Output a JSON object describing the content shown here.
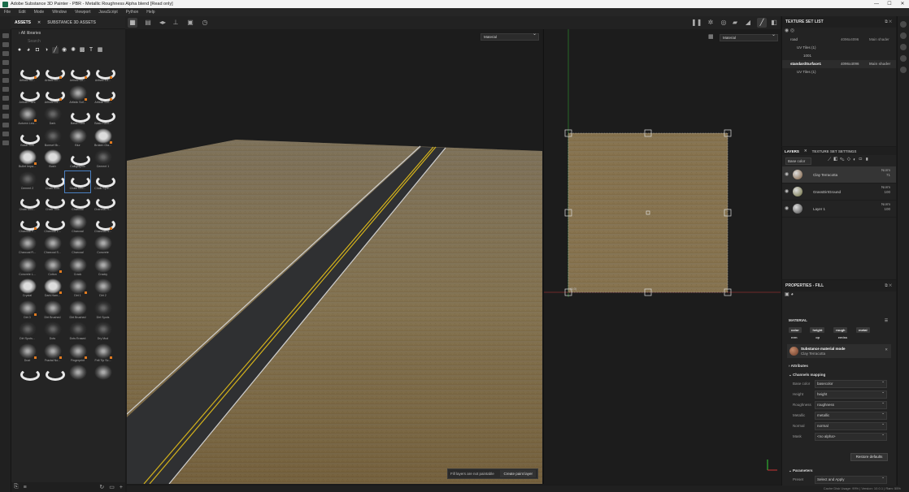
{
  "window": {
    "title": "Adobe Substance 3D Painter - PBR - Metallic Roughness Alpha blend [Read only]",
    "controls": [
      "—",
      "☐",
      "✕"
    ]
  },
  "menu": [
    "File",
    "Edit",
    "Mode",
    "Window",
    "Viewport",
    "JavaScript",
    "Python",
    "Help"
  ],
  "assets": {
    "tabs": [
      "ASSETS",
      "SUBSTANCE 3D ASSETS"
    ],
    "library": "All libraries",
    "search_placeholder": "Search",
    "items": [
      {
        "label": "Artistic He...",
        "kind": "sw",
        "badge": true
      },
      {
        "label": "Artistic Ex...",
        "kind": "sw",
        "badge": true
      },
      {
        "label": "Artistic Ge...",
        "kind": "sw",
        "badge": true
      },
      {
        "label": "Artistic Ed...",
        "kind": "sw",
        "badge": true
      },
      {
        "label": "Artistic Paint",
        "kind": "sw",
        "badge": false
      },
      {
        "label": "Artistic Lol...",
        "kind": "sw",
        "badge": true
      },
      {
        "label": "Artistic Sof...",
        "kind": "g",
        "badge": true
      },
      {
        "label": "Artistic Sof...",
        "kind": "sw",
        "badge": true
      },
      {
        "label": "Autumn Lea...",
        "kind": "g",
        "badge": true
      },
      {
        "label": "Dark",
        "kind": "d",
        "badge": false
      },
      {
        "label": "Basic Hard",
        "kind": "sw",
        "badge": false
      },
      {
        "label": "Basic Hard...",
        "kind": "sw",
        "badge": false
      },
      {
        "label": "Basic Soft",
        "kind": "sw",
        "badge": false
      },
      {
        "label": "Bomsef Br...",
        "kind": "d",
        "badge": false
      },
      {
        "label": "Blur",
        "kind": "g",
        "badge": false
      },
      {
        "label": "Broken Gla...",
        "kind": "w",
        "badge": true
      },
      {
        "label": "Bullet Impa...",
        "kind": "w",
        "badge": true
      },
      {
        "label": "Bush",
        "kind": "w",
        "badge": false
      },
      {
        "label": "Calligraphic",
        "kind": "sw",
        "badge": false
      },
      {
        "label": "Cement 1",
        "kind": "d",
        "badge": false
      },
      {
        "label": "Cement 2",
        "kind": "d",
        "badge": false
      },
      {
        "label": "Chalk Bold",
        "kind": "sw",
        "badge": false
      },
      {
        "label": "Chalk Stro...",
        "kind": "sw",
        "badge": false
      },
      {
        "label": "Chalk Spre...",
        "kind": "sw",
        "badge": false
      },
      {
        "label": "Chalk Stro...",
        "kind": "sw",
        "badge": false
      },
      {
        "label": "Chalk Thin",
        "kind": "sw",
        "badge": false
      },
      {
        "label": "Charcoal",
        "kind": "sw",
        "badge": false
      },
      {
        "label": "Charcoal Fi...",
        "kind": "sw",
        "badge": false
      },
      {
        "label": "Charcoal F...",
        "kind": "sw",
        "badge": true
      },
      {
        "label": "Charcoal L...",
        "kind": "sw",
        "badge": false
      },
      {
        "label": "Charcoal",
        "kind": "g",
        "badge": false
      },
      {
        "label": "Charcoal N...",
        "kind": "sw",
        "badge": true
      },
      {
        "label": "Charcoal R...",
        "kind": "g",
        "badge": false
      },
      {
        "label": "Charcoal S...",
        "kind": "g",
        "badge": false
      },
      {
        "label": "Charcoal",
        "kind": "g",
        "badge": false
      },
      {
        "label": "Concrete",
        "kind": "g",
        "badge": false
      },
      {
        "label": "Concrete L...",
        "kind": "g",
        "badge": false
      },
      {
        "label": "Cotton",
        "kind": "g",
        "badge": true
      },
      {
        "label": "Crack",
        "kind": "g",
        "badge": false
      },
      {
        "label": "Cracky",
        "kind": "g",
        "badge": false
      },
      {
        "label": "Crystal",
        "kind": "w",
        "badge": false
      },
      {
        "label": "Dark Ham...",
        "kind": "w",
        "badge": true
      },
      {
        "label": "Dirt 1",
        "kind": "g",
        "badge": true
      },
      {
        "label": "Dirt 2",
        "kind": "g",
        "badge": false
      },
      {
        "label": "Dirt 3",
        "kind": "g",
        "badge": true
      },
      {
        "label": "Dirt Brushed",
        "kind": "g",
        "badge": false
      },
      {
        "label": "Dirt Brushed",
        "kind": "g",
        "badge": false
      },
      {
        "label": "Dirt Spots",
        "kind": "d",
        "badge": false
      },
      {
        "label": "Dirt Spots...",
        "kind": "d",
        "badge": false
      },
      {
        "label": "Dots",
        "kind": "d",
        "badge": false
      },
      {
        "label": "Dots Erased",
        "kind": "d",
        "badge": false
      },
      {
        "label": "Dry Mud",
        "kind": "d",
        "badge": false
      },
      {
        "label": "Dust",
        "kind": "g",
        "badge": true
      },
      {
        "label": "Fractal No...",
        "kind": "g",
        "badge": true
      },
      {
        "label": "Fingerprint",
        "kind": "g",
        "badge": true
      },
      {
        "label": "Felt Tip Sc...",
        "kind": "g",
        "badge": true
      },
      {
        "label": "",
        "kind": "sw",
        "badge": false
      },
      {
        "label": "",
        "kind": "sw",
        "badge": false
      },
      {
        "label": "",
        "kind": "g",
        "badge": false
      },
      {
        "label": "",
        "kind": "g",
        "badge": false
      }
    ],
    "selected_index": 22
  },
  "viewport3d": {
    "mode": "Material"
  },
  "viewport2d": {
    "mode": "Material",
    "uv_label": "(0,0)"
  },
  "notice": {
    "text": "Fill layers are not paintable",
    "button": "Create paint layer"
  },
  "texture_set_list": {
    "title": "TEXTURE SET LIST",
    "rows": [
      {
        "name": "road",
        "res": "4096x4096",
        "shader": "Main shader",
        "bold": false,
        "indent": 0
      },
      {
        "name": "UV Tiles (1)",
        "res": "",
        "shader": "",
        "bold": false,
        "indent": 1
      },
      {
        "name": "1001",
        "res": "",
        "shader": "",
        "bold": false,
        "indent": 2
      },
      {
        "name": "standardSurface1",
        "res": "4096x4096",
        "shader": "Main shader",
        "bold": true,
        "indent": 0
      },
      {
        "name": "UV Tiles (1)",
        "res": "",
        "shader": "",
        "bold": false,
        "indent": 1
      }
    ]
  },
  "layers": {
    "tabs": [
      "LAYERS",
      "TEXTURE SET SETTINGS"
    ],
    "channel": "Base color",
    "items": [
      {
        "name": "Clay Terracotta",
        "blend": "Norm",
        "opacity": "71",
        "selected": true,
        "thumb": "#7a5a3a"
      },
      {
        "name": "GrassDirtGround",
        "blend": "Norm",
        "opacity": "100",
        "selected": false,
        "thumb": "#6a6a3a"
      },
      {
        "name": "Layer 1",
        "blend": "Norm",
        "opacity": "100",
        "selected": false,
        "thumb": "#444444"
      }
    ]
  },
  "properties": {
    "title": "PROPERTIES - FILL",
    "section": "MATERIAL",
    "channels_row1": [
      "color",
      "height",
      "rough",
      "metal"
    ],
    "channels_row2": [
      "nrm",
      "op",
      "emiss"
    ],
    "material_name": "Substance material mode",
    "material_sub": "Clay Terracotta",
    "attributes": "Attributes",
    "channels_mapping": "Channels mapping",
    "mappings": [
      {
        "k": "Base color",
        "v": "basecolor"
      },
      {
        "k": "Height",
        "v": "height"
      },
      {
        "k": "Roughness",
        "v": "roughness"
      },
      {
        "k": "Metallic",
        "v": "metallic"
      },
      {
        "k": "Normal",
        "v": "normal"
      },
      {
        "k": "Mask",
        "v": "<no alpha>"
      }
    ],
    "reset": "Restore defaults",
    "parameters": "Parameters",
    "preset_k": "Preset",
    "preset_v": "Select and Apply"
  },
  "status": "Cache Disk Usage: 99% | Version: 10.0.1 | Ram: 55%"
}
